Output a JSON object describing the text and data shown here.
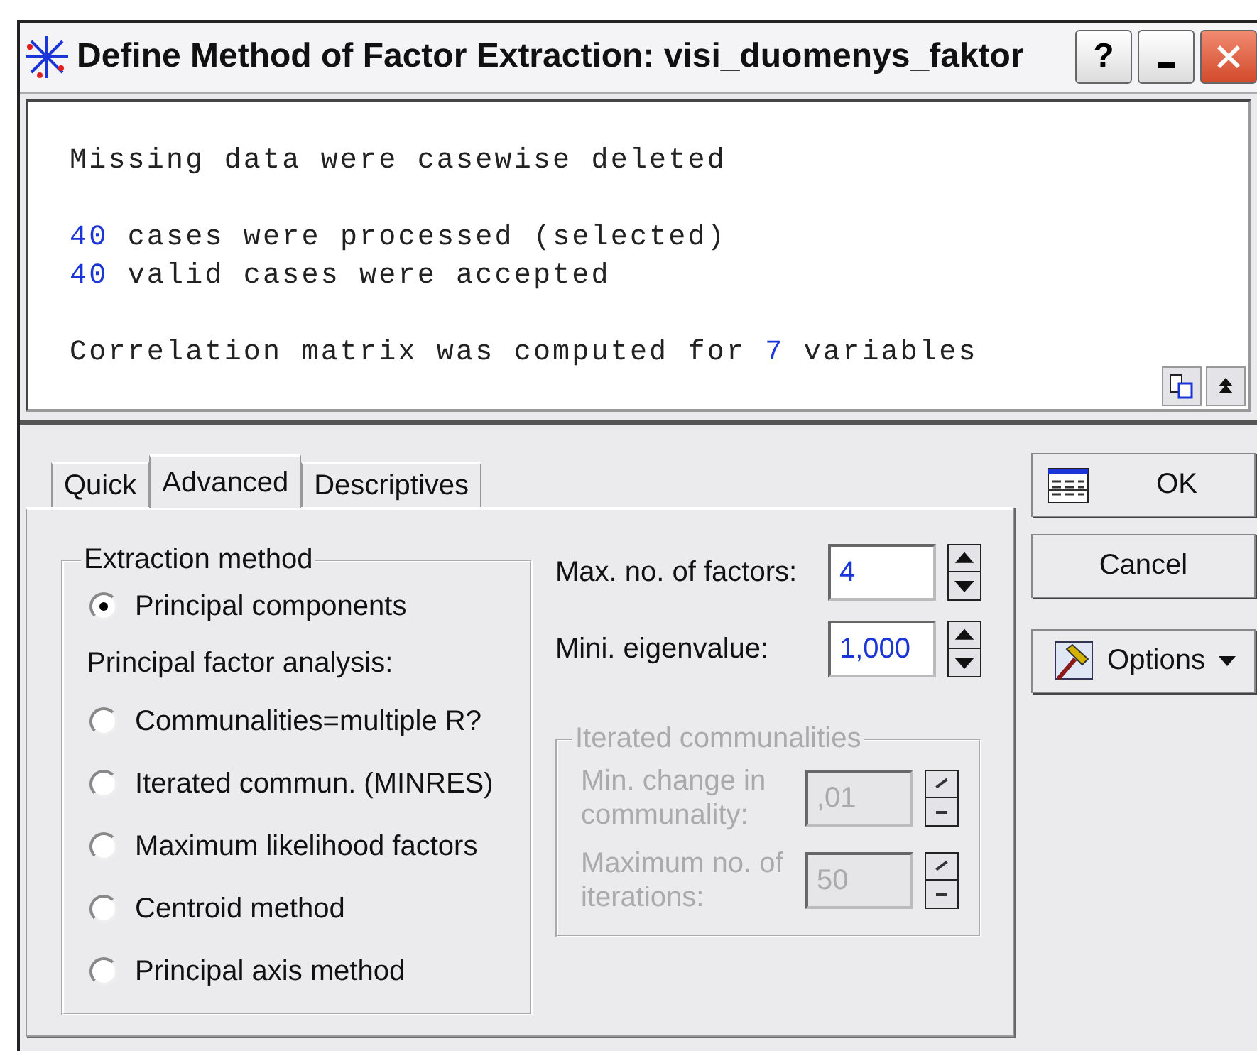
{
  "window": {
    "title": "Define Method of Factor Extraction: visi_duomenys_faktor",
    "buttons": [
      {
        "kind": "help",
        "label": "?"
      },
      {
        "kind": "minimize"
      },
      {
        "kind": "close"
      }
    ]
  },
  "output": {
    "blocks": [
      [
        {
          "parts": [
            {
              "kind": "plain",
              "text": "Missing data were casewise deleted"
            }
          ]
        }
      ],
      [
        {
          "parts": [
            {
              "kind": "number",
              "text": "40"
            },
            {
              "kind": "plain",
              "text": " cases were processed (selected)"
            }
          ]
        },
        {
          "parts": [
            {
              "kind": "number",
              "text": "40"
            },
            {
              "kind": "plain",
              "text": " valid cases were accepted"
            }
          ]
        }
      ],
      [
        {
          "parts": [
            {
              "kind": "plain",
              "text": "Correlation matrix was computed for "
            },
            {
              "kind": "number",
              "text": "7"
            },
            {
              "kind": "plain",
              "text": " variables"
            }
          ]
        }
      ]
    ]
  },
  "tabs": [
    {
      "label": "Quick",
      "selected": false
    },
    {
      "label": "Advanced",
      "selected": true
    },
    {
      "label": "Descriptives",
      "selected": false
    }
  ],
  "extraction": {
    "title": "Extraction method",
    "items": [
      {
        "kind": "radio",
        "label": "Principal components",
        "selected": true
      },
      {
        "kind": "heading",
        "label": "Principal factor analysis:"
      },
      {
        "kind": "radio",
        "label": "Communalities=multiple R?",
        "selected": false
      },
      {
        "kind": "radio",
        "label": "Iterated commun. (MINRES)",
        "selected": false
      },
      {
        "kind": "radio",
        "label": "Maximum likelihood factors",
        "selected": false
      },
      {
        "kind": "radio",
        "label": "Centroid method",
        "selected": false
      },
      {
        "kind": "radio",
        "label": "Principal axis method",
        "selected": false
      }
    ]
  },
  "settings": [
    {
      "label": "Max. no. of factors:",
      "value": "4"
    },
    {
      "label": "Mini. eigenvalue:",
      "value": "1,000"
    }
  ],
  "iterated": {
    "title": "Iterated communalities",
    "disabled": true,
    "fields": [
      {
        "label": "Min. change in communality:",
        "value": ",01"
      },
      {
        "label": "Maximum no. of iterations:",
        "value": "50"
      }
    ]
  },
  "actions": [
    {
      "kind": "ok",
      "label": "OK"
    },
    {
      "kind": "cancel",
      "label": "Cancel"
    },
    {
      "kind": "options",
      "label": "Options"
    }
  ]
}
